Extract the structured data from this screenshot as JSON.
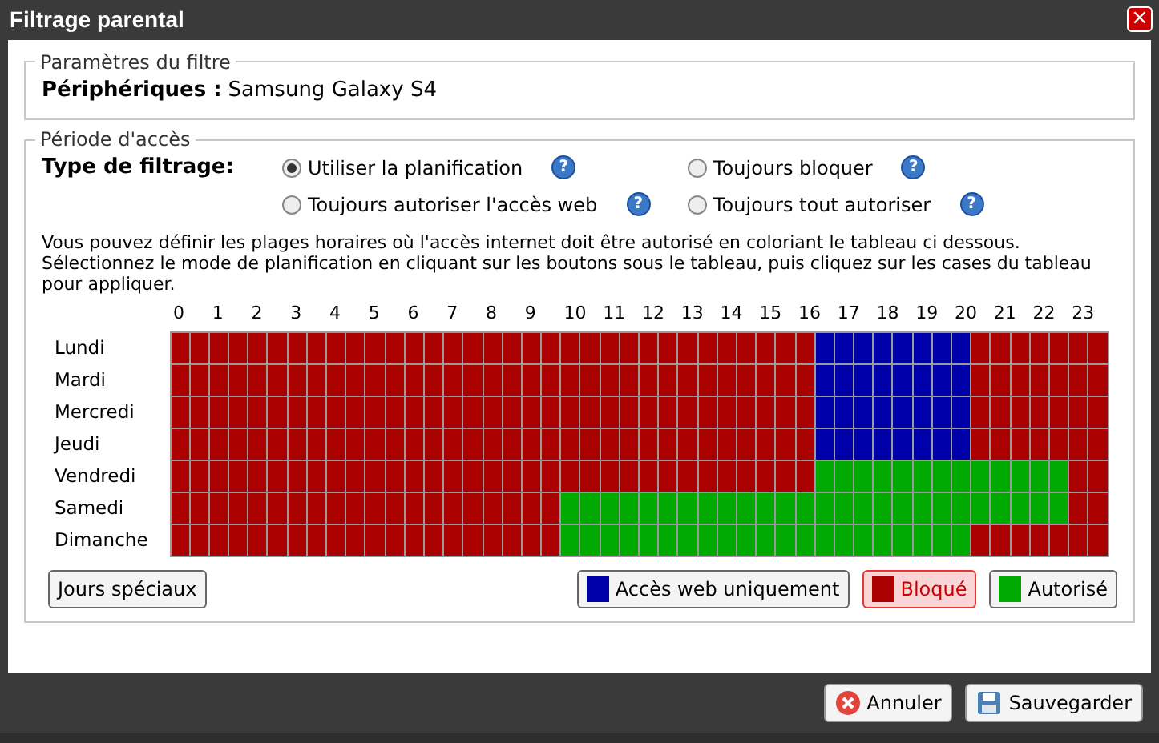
{
  "window": {
    "title": "Filtrage parental",
    "close": "×"
  },
  "filter_params": {
    "legend": "Paramètres du filtre",
    "label": "Périphériques :",
    "value": "Samsung Galaxy S4"
  },
  "access": {
    "legend": "Période d'accès",
    "type_label": "Type de filtrage:",
    "options": [
      {
        "label": "Utiliser la planification",
        "selected": true
      },
      {
        "label": "Toujours bloquer",
        "selected": false
      },
      {
        "label": "Toujours autoriser l'accès web",
        "selected": false
      },
      {
        "label": "Toujours tout autoriser",
        "selected": false
      }
    ],
    "help": "?",
    "instructions": "Vous pouvez définir les plages horaires où l'accès internet doit être autorisé en coloriant le tableau ci dessous.\nSélectionnez le mode de planification en cliquant sur les boutons sous le tableau, puis cliquez sur les cases du tableau pour appliquer.",
    "hours": [
      "0",
      "1",
      "2",
      "3",
      "4",
      "5",
      "6",
      "7",
      "8",
      "9",
      "10",
      "11",
      "12",
      "13",
      "14",
      "15",
      "16",
      "17",
      "18",
      "19",
      "20",
      "21",
      "22",
      "23"
    ],
    "days": [
      {
        "label": "Lundi",
        "cells": [
          {
            "kind": "blocked"
          },
          {
            "kind": "blocked"
          },
          {
            "kind": "blocked"
          },
          {
            "kind": "blocked"
          },
          {
            "kind": "blocked"
          },
          {
            "kind": "blocked"
          },
          {
            "kind": "blocked"
          },
          {
            "kind": "blocked"
          },
          {
            "kind": "blocked"
          },
          {
            "kind": "blocked"
          },
          {
            "kind": "blocked"
          },
          {
            "kind": "blocked"
          },
          {
            "kind": "blocked"
          },
          {
            "kind": "blocked"
          },
          {
            "kind": "blocked"
          },
          {
            "kind": "blocked"
          },
          {
            "kind": "blocked"
          },
          {
            "kind": "blocked"
          },
          {
            "kind": "blocked"
          },
          {
            "kind": "blocked"
          },
          {
            "kind": "blocked"
          },
          {
            "kind": "blocked"
          },
          {
            "kind": "blocked"
          },
          {
            "kind": "blocked"
          },
          {
            "kind": "blocked"
          },
          {
            "kind": "blocked"
          },
          {
            "kind": "blocked"
          },
          {
            "kind": "blocked"
          },
          {
            "kind": "blocked"
          },
          {
            "kind": "blocked"
          },
          {
            "kind": "blocked"
          },
          {
            "kind": "blocked"
          },
          {
            "kind": "blocked"
          },
          {
            "kind": "web"
          },
          {
            "kind": "web"
          },
          {
            "kind": "web"
          },
          {
            "kind": "web"
          },
          {
            "kind": "web"
          },
          {
            "kind": "web"
          },
          {
            "kind": "web"
          },
          {
            "kind": "web"
          },
          {
            "kind": "blocked"
          },
          {
            "kind": "blocked"
          },
          {
            "kind": "blocked"
          },
          {
            "kind": "blocked"
          },
          {
            "kind": "blocked"
          },
          {
            "kind": "blocked"
          },
          {
            "kind": "blocked"
          }
        ]
      },
      {
        "label": "Mardi",
        "cells": [
          {
            "kind": "blocked"
          },
          {
            "kind": "blocked"
          },
          {
            "kind": "blocked"
          },
          {
            "kind": "blocked"
          },
          {
            "kind": "blocked"
          },
          {
            "kind": "blocked"
          },
          {
            "kind": "blocked"
          },
          {
            "kind": "blocked"
          },
          {
            "kind": "blocked"
          },
          {
            "kind": "blocked"
          },
          {
            "kind": "blocked"
          },
          {
            "kind": "blocked"
          },
          {
            "kind": "blocked"
          },
          {
            "kind": "blocked"
          },
          {
            "kind": "blocked"
          },
          {
            "kind": "blocked"
          },
          {
            "kind": "blocked"
          },
          {
            "kind": "blocked"
          },
          {
            "kind": "blocked"
          },
          {
            "kind": "blocked"
          },
          {
            "kind": "blocked"
          },
          {
            "kind": "blocked"
          },
          {
            "kind": "blocked"
          },
          {
            "kind": "blocked"
          },
          {
            "kind": "blocked"
          },
          {
            "kind": "blocked"
          },
          {
            "kind": "blocked"
          },
          {
            "kind": "blocked"
          },
          {
            "kind": "blocked"
          },
          {
            "kind": "blocked"
          },
          {
            "kind": "blocked"
          },
          {
            "kind": "blocked"
          },
          {
            "kind": "blocked"
          },
          {
            "kind": "web"
          },
          {
            "kind": "web"
          },
          {
            "kind": "web"
          },
          {
            "kind": "web"
          },
          {
            "kind": "web"
          },
          {
            "kind": "web"
          },
          {
            "kind": "web"
          },
          {
            "kind": "web"
          },
          {
            "kind": "blocked"
          },
          {
            "kind": "blocked"
          },
          {
            "kind": "blocked"
          },
          {
            "kind": "blocked"
          },
          {
            "kind": "blocked"
          },
          {
            "kind": "blocked"
          },
          {
            "kind": "blocked"
          }
        ]
      },
      {
        "label": "Mercredi",
        "cells": [
          {
            "kind": "blocked"
          },
          {
            "kind": "blocked"
          },
          {
            "kind": "blocked"
          },
          {
            "kind": "blocked"
          },
          {
            "kind": "blocked"
          },
          {
            "kind": "blocked"
          },
          {
            "kind": "blocked"
          },
          {
            "kind": "blocked"
          },
          {
            "kind": "blocked"
          },
          {
            "kind": "blocked"
          },
          {
            "kind": "blocked"
          },
          {
            "kind": "blocked"
          },
          {
            "kind": "blocked"
          },
          {
            "kind": "blocked"
          },
          {
            "kind": "blocked"
          },
          {
            "kind": "blocked"
          },
          {
            "kind": "blocked"
          },
          {
            "kind": "blocked"
          },
          {
            "kind": "blocked"
          },
          {
            "kind": "blocked"
          },
          {
            "kind": "blocked"
          },
          {
            "kind": "blocked"
          },
          {
            "kind": "blocked"
          },
          {
            "kind": "blocked"
          },
          {
            "kind": "blocked"
          },
          {
            "kind": "blocked"
          },
          {
            "kind": "blocked"
          },
          {
            "kind": "blocked"
          },
          {
            "kind": "blocked"
          },
          {
            "kind": "blocked"
          },
          {
            "kind": "blocked"
          },
          {
            "kind": "blocked"
          },
          {
            "kind": "blocked"
          },
          {
            "kind": "web"
          },
          {
            "kind": "web"
          },
          {
            "kind": "web"
          },
          {
            "kind": "web"
          },
          {
            "kind": "web"
          },
          {
            "kind": "web"
          },
          {
            "kind": "web"
          },
          {
            "kind": "web"
          },
          {
            "kind": "blocked"
          },
          {
            "kind": "blocked"
          },
          {
            "kind": "blocked"
          },
          {
            "kind": "blocked"
          },
          {
            "kind": "blocked"
          },
          {
            "kind": "blocked"
          },
          {
            "kind": "blocked"
          }
        ]
      },
      {
        "label": "Jeudi",
        "cells": [
          {
            "kind": "blocked"
          },
          {
            "kind": "blocked"
          },
          {
            "kind": "blocked"
          },
          {
            "kind": "blocked"
          },
          {
            "kind": "blocked"
          },
          {
            "kind": "blocked"
          },
          {
            "kind": "blocked"
          },
          {
            "kind": "blocked"
          },
          {
            "kind": "blocked"
          },
          {
            "kind": "blocked"
          },
          {
            "kind": "blocked"
          },
          {
            "kind": "blocked"
          },
          {
            "kind": "blocked"
          },
          {
            "kind": "blocked"
          },
          {
            "kind": "blocked"
          },
          {
            "kind": "blocked"
          },
          {
            "kind": "blocked"
          },
          {
            "kind": "blocked"
          },
          {
            "kind": "blocked"
          },
          {
            "kind": "blocked"
          },
          {
            "kind": "blocked"
          },
          {
            "kind": "blocked"
          },
          {
            "kind": "blocked"
          },
          {
            "kind": "blocked"
          },
          {
            "kind": "blocked"
          },
          {
            "kind": "blocked"
          },
          {
            "kind": "blocked"
          },
          {
            "kind": "blocked"
          },
          {
            "kind": "blocked"
          },
          {
            "kind": "blocked"
          },
          {
            "kind": "blocked"
          },
          {
            "kind": "blocked"
          },
          {
            "kind": "blocked"
          },
          {
            "kind": "web"
          },
          {
            "kind": "web"
          },
          {
            "kind": "web"
          },
          {
            "kind": "web"
          },
          {
            "kind": "web"
          },
          {
            "kind": "web"
          },
          {
            "kind": "web"
          },
          {
            "kind": "web"
          },
          {
            "kind": "blocked"
          },
          {
            "kind": "blocked"
          },
          {
            "kind": "blocked"
          },
          {
            "kind": "blocked"
          },
          {
            "kind": "blocked"
          },
          {
            "kind": "blocked"
          },
          {
            "kind": "blocked"
          }
        ]
      },
      {
        "label": "Vendredi",
        "cells": [
          {
            "kind": "blocked"
          },
          {
            "kind": "blocked"
          },
          {
            "kind": "blocked"
          },
          {
            "kind": "blocked"
          },
          {
            "kind": "blocked"
          },
          {
            "kind": "blocked"
          },
          {
            "kind": "blocked"
          },
          {
            "kind": "blocked"
          },
          {
            "kind": "blocked"
          },
          {
            "kind": "blocked"
          },
          {
            "kind": "blocked"
          },
          {
            "kind": "blocked"
          },
          {
            "kind": "blocked"
          },
          {
            "kind": "blocked"
          },
          {
            "kind": "blocked"
          },
          {
            "kind": "blocked"
          },
          {
            "kind": "blocked"
          },
          {
            "kind": "blocked"
          },
          {
            "kind": "blocked"
          },
          {
            "kind": "blocked"
          },
          {
            "kind": "blocked"
          },
          {
            "kind": "blocked"
          },
          {
            "kind": "blocked"
          },
          {
            "kind": "blocked"
          },
          {
            "kind": "blocked"
          },
          {
            "kind": "blocked"
          },
          {
            "kind": "blocked"
          },
          {
            "kind": "blocked"
          },
          {
            "kind": "blocked"
          },
          {
            "kind": "blocked"
          },
          {
            "kind": "blocked"
          },
          {
            "kind": "blocked"
          },
          {
            "kind": "blocked"
          },
          {
            "kind": "allowed"
          },
          {
            "kind": "allowed"
          },
          {
            "kind": "allowed"
          },
          {
            "kind": "allowed"
          },
          {
            "kind": "allowed"
          },
          {
            "kind": "allowed"
          },
          {
            "kind": "allowed"
          },
          {
            "kind": "allowed"
          },
          {
            "kind": "allowed"
          },
          {
            "kind": "allowed"
          },
          {
            "kind": "allowed"
          },
          {
            "kind": "allowed"
          },
          {
            "kind": "allowed"
          },
          {
            "kind": "blocked"
          },
          {
            "kind": "blocked"
          }
        ]
      },
      {
        "label": "Samedi",
        "cells": [
          {
            "kind": "blocked"
          },
          {
            "kind": "blocked"
          },
          {
            "kind": "blocked"
          },
          {
            "kind": "blocked"
          },
          {
            "kind": "blocked"
          },
          {
            "kind": "blocked"
          },
          {
            "kind": "blocked"
          },
          {
            "kind": "blocked"
          },
          {
            "kind": "blocked"
          },
          {
            "kind": "blocked"
          },
          {
            "kind": "blocked"
          },
          {
            "kind": "blocked"
          },
          {
            "kind": "blocked"
          },
          {
            "kind": "blocked"
          },
          {
            "kind": "blocked"
          },
          {
            "kind": "blocked"
          },
          {
            "kind": "blocked"
          },
          {
            "kind": "blocked"
          },
          {
            "kind": "blocked"
          },
          {
            "kind": "blocked"
          },
          {
            "kind": "allowed"
          },
          {
            "kind": "allowed"
          },
          {
            "kind": "allowed"
          },
          {
            "kind": "allowed"
          },
          {
            "kind": "allowed"
          },
          {
            "kind": "allowed"
          },
          {
            "kind": "allowed"
          },
          {
            "kind": "allowed"
          },
          {
            "kind": "allowed"
          },
          {
            "kind": "allowed"
          },
          {
            "kind": "allowed"
          },
          {
            "kind": "allowed"
          },
          {
            "kind": "allowed"
          },
          {
            "kind": "allowed"
          },
          {
            "kind": "allowed"
          },
          {
            "kind": "allowed"
          },
          {
            "kind": "allowed"
          },
          {
            "kind": "allowed"
          },
          {
            "kind": "allowed"
          },
          {
            "kind": "allowed"
          },
          {
            "kind": "allowed"
          },
          {
            "kind": "allowed"
          },
          {
            "kind": "allowed"
          },
          {
            "kind": "allowed"
          },
          {
            "kind": "allowed"
          },
          {
            "kind": "allowed"
          },
          {
            "kind": "blocked"
          },
          {
            "kind": "blocked"
          }
        ]
      },
      {
        "label": "Dimanche",
        "cells": [
          {
            "kind": "blocked"
          },
          {
            "kind": "blocked"
          },
          {
            "kind": "blocked"
          },
          {
            "kind": "blocked"
          },
          {
            "kind": "blocked"
          },
          {
            "kind": "blocked"
          },
          {
            "kind": "blocked"
          },
          {
            "kind": "blocked"
          },
          {
            "kind": "blocked"
          },
          {
            "kind": "blocked"
          },
          {
            "kind": "blocked"
          },
          {
            "kind": "blocked"
          },
          {
            "kind": "blocked"
          },
          {
            "kind": "blocked"
          },
          {
            "kind": "blocked"
          },
          {
            "kind": "blocked"
          },
          {
            "kind": "blocked"
          },
          {
            "kind": "blocked"
          },
          {
            "kind": "blocked"
          },
          {
            "kind": "blocked"
          },
          {
            "kind": "allowed"
          },
          {
            "kind": "allowed"
          },
          {
            "kind": "allowed"
          },
          {
            "kind": "allowed"
          },
          {
            "kind": "allowed"
          },
          {
            "kind": "allowed"
          },
          {
            "kind": "allowed"
          },
          {
            "kind": "allowed"
          },
          {
            "kind": "allowed"
          },
          {
            "kind": "allowed"
          },
          {
            "kind": "allowed"
          },
          {
            "kind": "allowed"
          },
          {
            "kind": "allowed"
          },
          {
            "kind": "allowed"
          },
          {
            "kind": "allowed"
          },
          {
            "kind": "allowed"
          },
          {
            "kind": "allowed"
          },
          {
            "kind": "allowed"
          },
          {
            "kind": "allowed"
          },
          {
            "kind": "allowed"
          },
          {
            "kind": "allowed"
          },
          {
            "kind": "blocked"
          },
          {
            "kind": "blocked"
          },
          {
            "kind": "blocked"
          },
          {
            "kind": "blocked"
          },
          {
            "kind": "blocked"
          },
          {
            "kind": "blocked"
          },
          {
            "kind": "blocked"
          }
        ]
      }
    ],
    "special_days": "Jours spéciaux",
    "modes": [
      {
        "kind": "web",
        "label": "Accès web uniquement",
        "color": "#0000aa",
        "selected": false
      },
      {
        "kind": "blocked",
        "label": "Bloqué",
        "color": "#aa0000",
        "selected": true
      },
      {
        "kind": "allowed",
        "label": "Autorisé",
        "color": "#00aa00",
        "selected": false
      }
    ]
  },
  "footer": {
    "cancel": "Annuler",
    "save": "Sauvegarder"
  }
}
